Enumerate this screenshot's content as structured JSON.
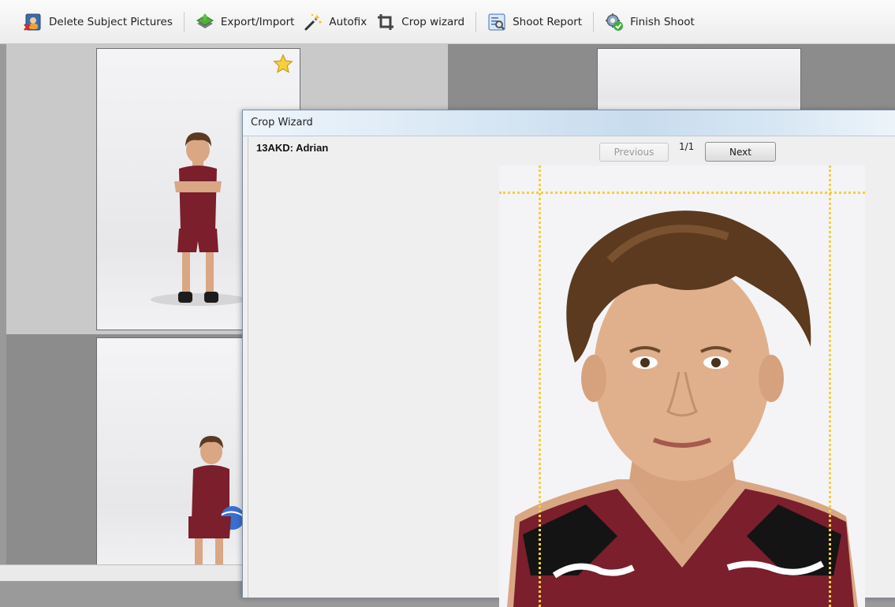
{
  "toolbar": {
    "delete_label": "Delete Subject Pictures",
    "export_label": "Export/Import",
    "autofix_label": "Autofix",
    "crop_label": "Crop wizard",
    "report_label": "Shoot Report",
    "finish_label": "Finish Shoot"
  },
  "dialog": {
    "title": "Crop Wizard",
    "subject": "13AKD: Adrian",
    "previous_label": "Previous",
    "page": "1/1",
    "next_label": "Next"
  },
  "colors": {
    "guide": "#f5cf3c",
    "jersey": "#7a1f2b",
    "accent": "#4a7fb5"
  },
  "icons": [
    "delete-subject-icon",
    "export-import-icon",
    "autofix-wand-icon",
    "crop-icon",
    "shoot-report-icon",
    "finish-shoot-gear-icon",
    "favorite-star-icon"
  ]
}
